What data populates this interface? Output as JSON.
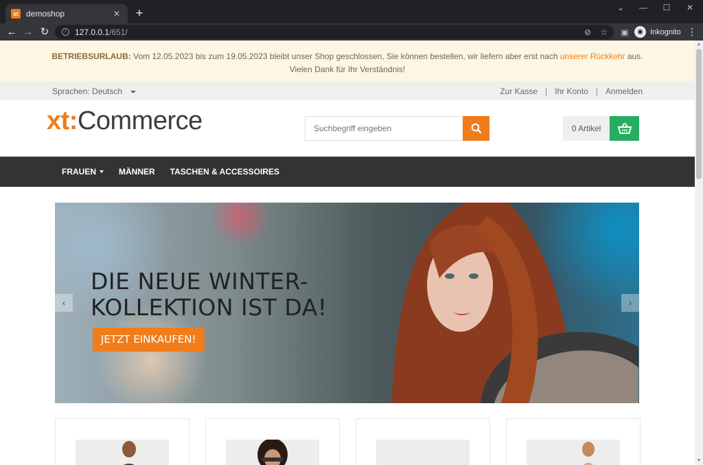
{
  "browser": {
    "tab_title": "demoshop",
    "tab_favicon": "xt",
    "url_host": "127.0.0.1",
    "url_path": "/651/",
    "profile_label": "Inkognito"
  },
  "notice": {
    "label": "BETRIEBSURLAUB:",
    "text": " Vom 12.05.2023 bis zum 19.05.2023 bleibt unser Shop geschlossen, Sie können bestellen, wir liefern aber erst nach ",
    "link": "unserer Rückkehr",
    "end": " aus.",
    "line2": "Vielen Dank für Ihr Verständnis!"
  },
  "topbar": {
    "language": "Sprachen: Deutsch",
    "links": [
      "Zur Kasse",
      "Ihr Konto",
      "Anmelden"
    ]
  },
  "header": {
    "logo_xt": "xt:",
    "logo_rest": "Commerce",
    "search_placeholder": "Suchbegriff eingeben",
    "cart_count": "0 Artikel"
  },
  "nav": {
    "items": [
      "FRAUEN",
      "MÄNNER",
      "TASCHEN & ACCESSOIRES"
    ]
  },
  "hero": {
    "title_line1": "DIE NEUE WINTER-",
    "title_line2": "KOLLEKTION IST DA!",
    "cta": "JETZT EINKAUFEN!"
  },
  "colors": {
    "accent": "#f07d1a",
    "cart_green": "#27ae60",
    "nav_bg": "#333333",
    "notice_bg": "#fcf6e3"
  },
  "icons": [
    "search-icon",
    "basket-icon",
    "chevron-left-icon",
    "chevron-right-icon",
    "info-icon",
    "star-icon",
    "eye-off-icon",
    "sidebar-icon"
  ]
}
